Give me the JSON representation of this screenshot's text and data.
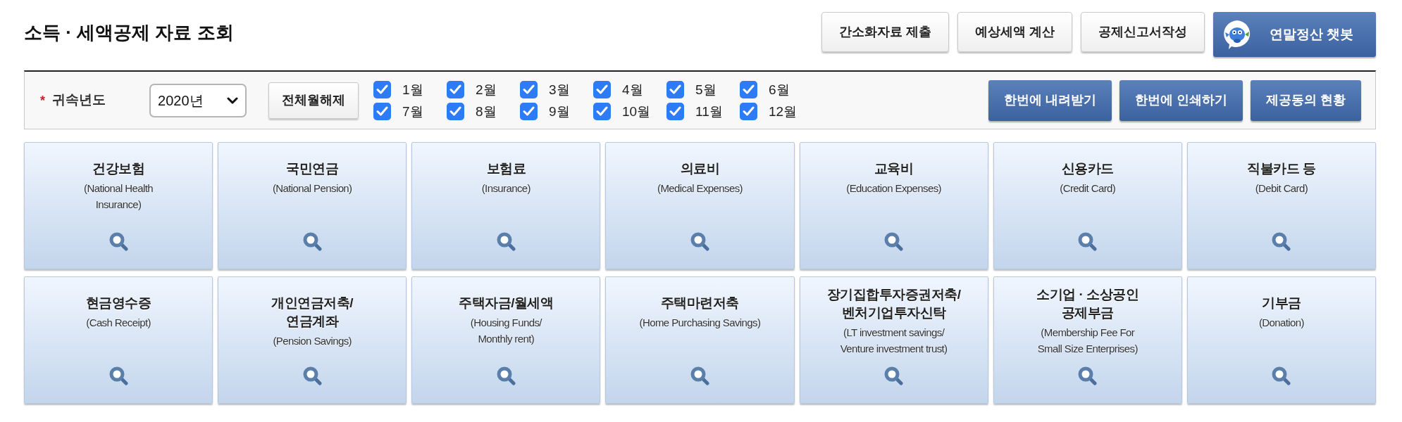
{
  "page_title": "소득 · 세액공제 자료 조회",
  "top_buttons": [
    {
      "kind": "plain",
      "label": "간소화자료 제출"
    },
    {
      "kind": "plain",
      "label": "예상세액 계산"
    },
    {
      "kind": "plain",
      "label": "공제신고서작성"
    },
    {
      "kind": "chatbot",
      "label": "연말정산 챗봇"
    }
  ],
  "filter": {
    "required_mark": "*",
    "label": "귀속년도",
    "year_select": {
      "value": "2020년"
    },
    "clear_button": "전체월해제",
    "months": [
      {
        "label": "1월",
        "checked": true
      },
      {
        "label": "2월",
        "checked": true
      },
      {
        "label": "3월",
        "checked": true
      },
      {
        "label": "4월",
        "checked": true
      },
      {
        "label": "5월",
        "checked": true
      },
      {
        "label": "6월",
        "checked": true
      },
      {
        "label": "7월",
        "checked": true
      },
      {
        "label": "8월",
        "checked": true
      },
      {
        "label": "9월",
        "checked": true
      },
      {
        "label": "10월",
        "checked": true
      },
      {
        "label": "11월",
        "checked": true
      },
      {
        "label": "12월",
        "checked": true
      }
    ],
    "action_buttons": [
      "한번에 내려받기",
      "한번에 인쇄하기",
      "제공동의 현황"
    ]
  },
  "categories": [
    {
      "title": "건강보험",
      "subtitle": "(National Health\nInsurance)"
    },
    {
      "title": "국민연금",
      "subtitle": "(National Pension)"
    },
    {
      "title": "보험료",
      "subtitle": "(Insurance)"
    },
    {
      "title": "의료비",
      "subtitle": "(Medical Expenses)"
    },
    {
      "title": "교육비",
      "subtitle": "(Education Expenses)"
    },
    {
      "title": "신용카드",
      "subtitle": "(Credit Card)"
    },
    {
      "title": "직불카드 등",
      "subtitle": "(Debit Card)"
    },
    {
      "title": "현금영수증",
      "subtitle": "(Cash Receipt)"
    },
    {
      "title": "개인연금저축/\n연금계좌",
      "subtitle": "(Pension Savings)"
    },
    {
      "title": "주택자금/월세액",
      "subtitle": "(Housing Funds/\nMonthly rent)"
    },
    {
      "title": "주택마련저축",
      "subtitle": "(Home Purchasing Savings)"
    },
    {
      "title": "장기집합투자증권저축/\n벤처기업투자신탁",
      "subtitle": "(LT investment savings/\nVenture investment trust)"
    },
    {
      "title": "소기업 · 소상공인\n공제부금",
      "subtitle": "(Membership Fee For\nSmall Size Enterprises)"
    },
    {
      "title": "기부금",
      "subtitle": "(Donation)"
    }
  ]
}
